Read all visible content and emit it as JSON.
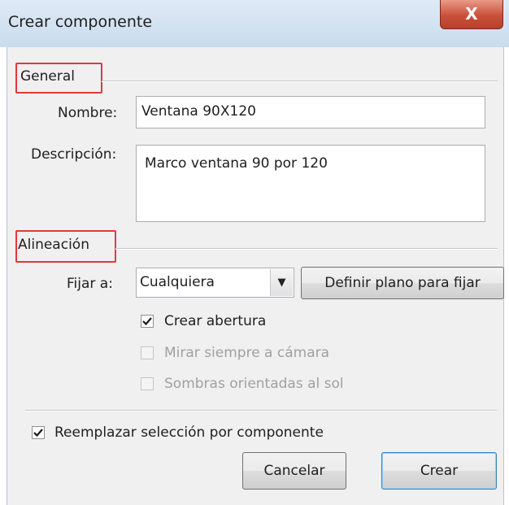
{
  "dialog": {
    "title": "Crear componente",
    "close_glyph": "X"
  },
  "general": {
    "group_label": "General",
    "name_label": "Nombre:",
    "name_value": "Ventana 90X120",
    "description_label": "Descripción:",
    "description_value": "Marco ventana 90 por 120"
  },
  "alignment": {
    "group_label": "Alineación",
    "glue_label": "Fijar a:",
    "glue_value": "Cualquiera",
    "define_plane_button": "Definir plano para fijar",
    "cut_opening": {
      "label": "Crear abertura",
      "checked": true,
      "enabled": true
    },
    "face_camera": {
      "label": "Mirar siempre a cámara",
      "checked": false,
      "enabled": false
    },
    "shadows_sun": {
      "label": "Sombras orientadas al sol",
      "checked": false,
      "enabled": false
    }
  },
  "replace_selection": {
    "label": "Reemplazar selección por componente",
    "checked": true
  },
  "buttons": {
    "cancel": "Cancelar",
    "create": "Crear"
  },
  "colors": {
    "highlight_box": "#e03a3a",
    "titlebar": "#c9dced",
    "close_button": "#c9503b"
  },
  "icons": {
    "close": "close-icon",
    "dropdown": "chevron-down-icon",
    "check": "check-icon"
  }
}
